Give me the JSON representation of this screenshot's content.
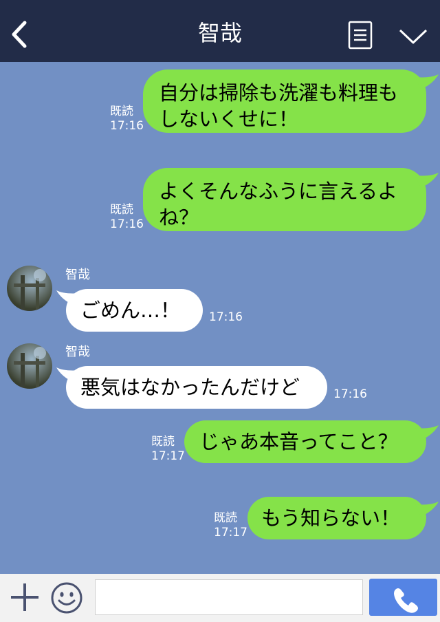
{
  "header": {
    "title": "智哉",
    "back_icon": "chevron-left-icon",
    "menu_icon": "list-icon",
    "collapse_icon": "chevron-down-icon"
  },
  "messages": [
    {
      "side": "sent",
      "lines": [
        "自分は掃除も洗濯も料理も",
        "しないくせに！"
      ],
      "read": "既読",
      "time": "17:16"
    },
    {
      "side": "sent",
      "lines": [
        "よくそんなふうに言えるよ",
        "ね？"
      ],
      "read": "既読",
      "time": "17:16"
    },
    {
      "side": "recv",
      "sender": "智哉",
      "lines": [
        "ごめん…！"
      ],
      "time": "17:16"
    },
    {
      "side": "recv",
      "sender": "智哉",
      "lines": [
        "悪気はなかったんだけど"
      ],
      "time": "17:16"
    },
    {
      "side": "sent",
      "lines": [
        "じゃあ本音ってこと？"
      ],
      "read": "既読",
      "time": "17:17"
    },
    {
      "side": "sent",
      "lines": [
        "もう知らない！"
      ],
      "read": "既読",
      "time": "17:17"
    }
  ],
  "input": {
    "value": "",
    "placeholder": ""
  },
  "toolbar": {
    "plus_icon": "plus-icon",
    "emoji_icon": "smiley-icon",
    "call_icon": "phone-icon"
  },
  "colors": {
    "header_bg": "#222c48",
    "chat_bg": "#7290c4",
    "sent_bubble": "#85e249",
    "received_bubble": "#ffffff",
    "call_button": "#5584e4"
  }
}
